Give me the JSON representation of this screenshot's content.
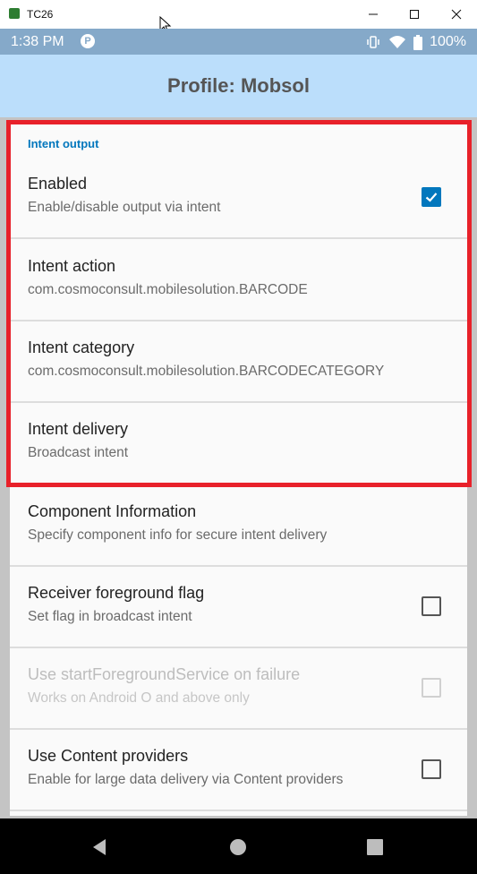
{
  "window": {
    "title": "TC26",
    "controls": {
      "minimize_icon": "minimize-icon",
      "maximize_icon": "maximize-icon",
      "close_icon": "close-icon"
    }
  },
  "status_bar": {
    "time": "1:38 PM",
    "battery": "100%",
    "icons": [
      "app-notification-icon",
      "vibrate-icon",
      "wifi-icon",
      "battery-icon"
    ]
  },
  "app_bar": {
    "title": "Profile: Mobsol"
  },
  "section": {
    "title": "Intent output"
  },
  "preferences": [
    {
      "title": "Enabled",
      "summary": "Enable/disable output via intent",
      "checkbox": true,
      "checked": true,
      "enabled": true
    },
    {
      "title": "Intent action",
      "summary": "com.cosmoconsult.mobilesolution.BARCODE",
      "checkbox": false,
      "enabled": true
    },
    {
      "title": "Intent category",
      "summary": "com.cosmoconsult.mobilesolution.BARCODECATEGORY",
      "checkbox": false,
      "enabled": true
    },
    {
      "title": "Intent delivery",
      "summary": "Broadcast intent",
      "checkbox": false,
      "enabled": true
    },
    {
      "title": "Component Information",
      "summary": "Specify component info for secure intent delivery",
      "checkbox": false,
      "enabled": true
    },
    {
      "title": "Receiver foreground flag",
      "summary": "Set flag in broadcast intent",
      "checkbox": true,
      "checked": false,
      "enabled": true
    },
    {
      "title": "Use startForegroundService on failure",
      "summary": "Works on Android O and above only",
      "checkbox": true,
      "checked": false,
      "enabled": false
    },
    {
      "title": "Use Content providers",
      "summary": "Enable for large data delivery via Content providers",
      "checkbox": true,
      "checked": false,
      "enabled": true
    }
  ],
  "colors": {
    "accent": "#0277bd",
    "app_bar": "#bbdefb",
    "status_bar": "#85a9c9",
    "highlight": "#e8212a"
  }
}
